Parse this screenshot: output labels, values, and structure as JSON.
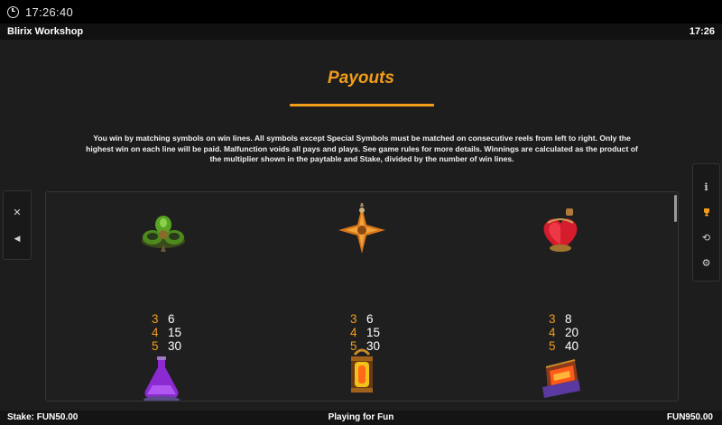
{
  "status_bar": {
    "time": "17:26:40",
    "icon": "clock-icon"
  },
  "title_bar": {
    "game_name": "Blirix Workshop",
    "time": "17:26"
  },
  "paytable": {
    "heading": "Payouts",
    "intro": "You win by matching symbols on win lines. All symbols except Special Symbols must be matched on consecutive reels from left to right. Only the highest win on each line will be paid. Malfunction voids all pays and plays. See game rules for more details. Winnings are calculated as the product of the multiplier shown in the paytable and Stake, divided by the number of win lines.",
    "symbols": [
      {
        "icon": "green-clover-gadget-icon",
        "pays": [
          {
            "count": "3",
            "value": "6"
          },
          {
            "count": "4",
            "value": "15"
          },
          {
            "count": "5",
            "value": "30"
          }
        ]
      },
      {
        "icon": "orange-star-gadget-icon",
        "pays": [
          {
            "count": "3",
            "value": "6"
          },
          {
            "count": "4",
            "value": "15"
          },
          {
            "count": "5",
            "value": "30"
          }
        ]
      },
      {
        "icon": "red-heart-potion-icon",
        "pays": [
          {
            "count": "3",
            "value": "8"
          },
          {
            "count": "4",
            "value": "20"
          },
          {
            "count": "5",
            "value": "40"
          }
        ]
      },
      {
        "icon": "purple-flask-icon"
      },
      {
        "icon": "lantern-icon"
      },
      {
        "icon": "treasure-chest-icon"
      }
    ]
  },
  "side_menu_left": [
    {
      "icon": "close-icon",
      "glyph": "✕"
    },
    {
      "icon": "sound-icon",
      "glyph": "◀"
    }
  ],
  "side_menu_right": [
    {
      "icon": "info-icon",
      "glyph": "i"
    },
    {
      "icon": "trophy-icon",
      "glyph": "🏆"
    },
    {
      "icon": "history-icon",
      "glyph": "⟲"
    },
    {
      "icon": "settings-icon",
      "glyph": "⚙"
    }
  ],
  "footer": {
    "stake_label": "Stake:",
    "stake_value": "FUN50.00",
    "mode": "Playing for Fun",
    "balance": "FUN950.00"
  },
  "colors": {
    "accent": "#f29d1c",
    "background": "#1d1d1d"
  }
}
